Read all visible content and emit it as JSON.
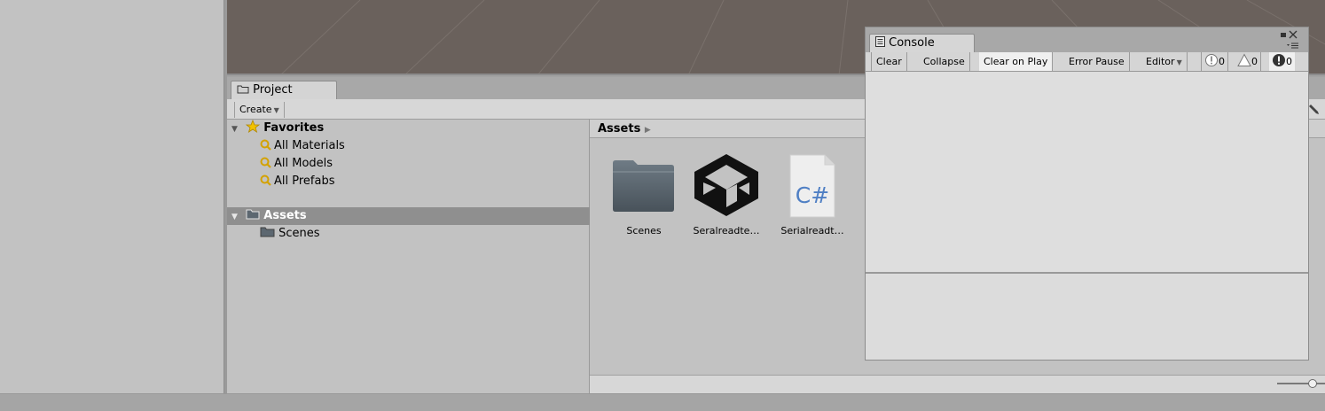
{
  "project": {
    "tab_title": "Project",
    "create_label": "Create",
    "tree": {
      "favorites_label": "Favorites",
      "favorites_items": [
        "All Materials",
        "All Models",
        "All Prefabs"
      ],
      "assets_label": "Assets",
      "assets_children": [
        "Scenes"
      ]
    },
    "breadcrumb": "Assets",
    "assets": [
      {
        "label": "Scenes",
        "icon": "folder-icon"
      },
      {
        "label": "Seralreadte…",
        "icon": "unity-logo-icon"
      },
      {
        "label": "Serialreadt…",
        "icon": "csharp-script-icon"
      }
    ],
    "csharp_glyph": "C#",
    "zoom_slider_level": 1.0
  },
  "console": {
    "tab_title": "Console",
    "buttons": {
      "clear": "Clear",
      "collapse": "Collapse",
      "clear_on_play": "Clear on Play",
      "error_pause": "Error Pause",
      "editor": "Editor"
    },
    "counts": {
      "info": "0",
      "warning": "0",
      "error": "0"
    }
  },
  "colors": {
    "scene_bg": "#6a615c",
    "selection": "#8f8f8f",
    "csharp_blue": "#4f7fc4",
    "favorites_star": "#f2c200"
  }
}
